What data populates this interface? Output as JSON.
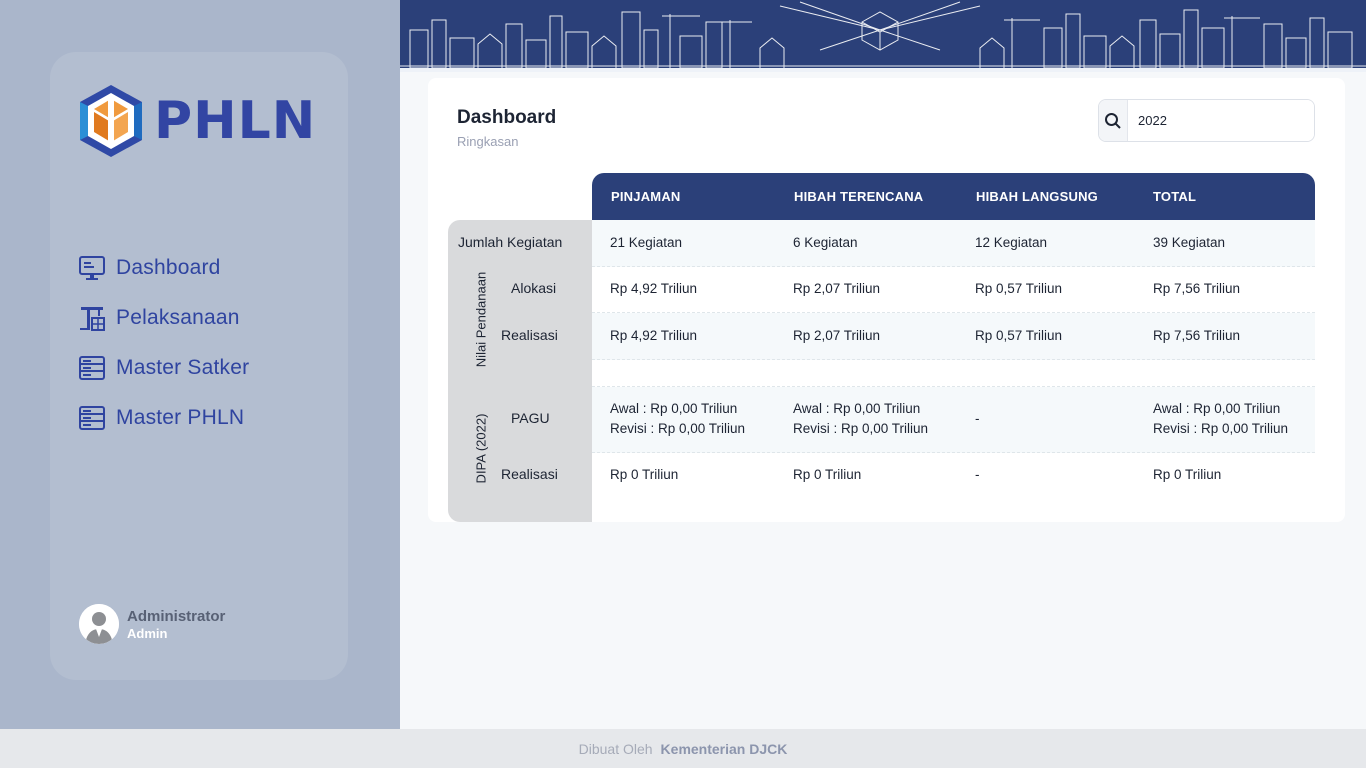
{
  "brand": {
    "name": "PHLN"
  },
  "nav": [
    {
      "label": "Dashboard",
      "icon": "monitor-icon"
    },
    {
      "label": "Pelaksanaan",
      "icon": "crane-icon"
    },
    {
      "label": "Master Satker",
      "icon": "server-icon"
    },
    {
      "label": "Master PHLN",
      "icon": "server-icon"
    }
  ],
  "user": {
    "name": "Administrator",
    "role": "Admin"
  },
  "page": {
    "title": "Dashboard",
    "subtitle": "Ringkasan"
  },
  "search": {
    "value": "2022"
  },
  "table": {
    "headers": [
      "PINJAMAN",
      "HIBAH TERENCANA",
      "HIBAH LANGSUNG",
      "TOTAL"
    ],
    "group_labels": {
      "nilai": "Nilai Pendanaan",
      "dipa": "DIPA (2022)"
    },
    "row_labels": {
      "jumlah": "Jumlah Kegiatan",
      "alokasi": "Alokasi",
      "realisasi": "Realisasi",
      "pagu": "PAGU",
      "dipa_realisasi": "Realisasi"
    },
    "jumlah": [
      "21 Kegiatan",
      "6 Kegiatan",
      "12 Kegiatan",
      "39 Kegiatan"
    ],
    "alokasi": [
      "Rp 4,92 Triliun",
      "Rp 2,07 Triliun",
      "Rp 0,57 Triliun",
      "Rp 7,56 Triliun"
    ],
    "realisasi": [
      "Rp 4,92 Triliun",
      "Rp 2,07 Triliun",
      "Rp 0,57 Triliun",
      "Rp 7,56 Triliun"
    ],
    "pagu_awal": [
      "Awal : Rp 0,00 Triliun",
      "Awal : Rp 0,00 Triliun",
      "-",
      "Awal : Rp 0,00 Triliun"
    ],
    "pagu_revisi": [
      "Revisi : Rp 0,00 Triliun",
      "Revisi : Rp 0,00 Triliun",
      "",
      "Revisi : Rp 0,00 Triliun"
    ],
    "dipa_realisasi": [
      "Rp 0 Triliun",
      "Rp 0 Triliun",
      "-",
      "Rp 0 Triliun"
    ]
  },
  "footer": {
    "prefix": "Dibuat Oleh",
    "org": "Kementerian DJCK"
  },
  "colors": {
    "primary": "#2b4079",
    "accent": "#e8862a",
    "sidebar": "#aab6cb"
  }
}
